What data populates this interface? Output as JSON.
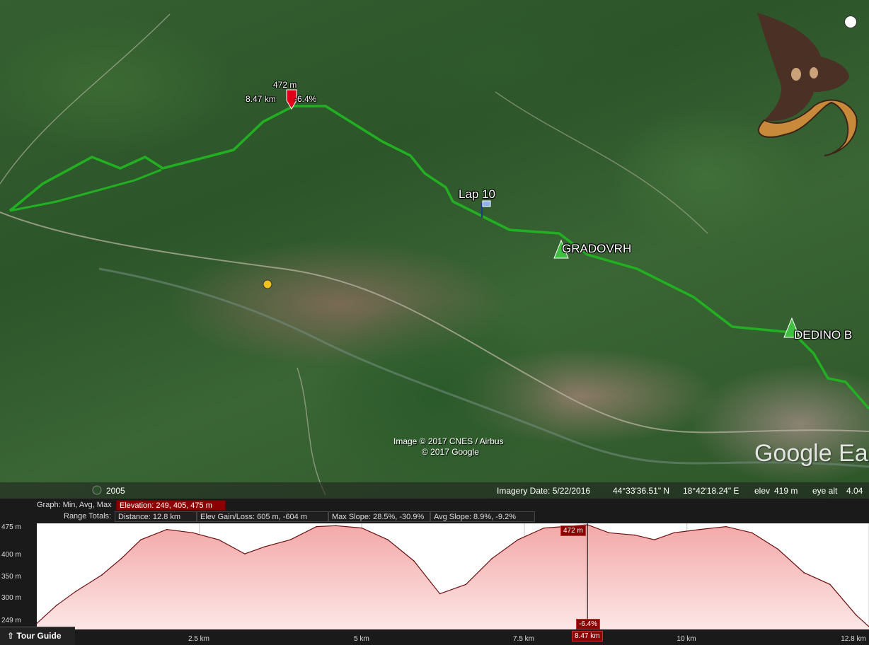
{
  "map": {
    "placemarks": {
      "gradovrh": "GRADOVRH",
      "dedino": "DEDINO B",
      "lap": "Lap 10"
    },
    "cursor_marker": {
      "elevation": "472 m",
      "distance": "8.47 km",
      "slope": "-6.4%"
    },
    "attribution": {
      "line1": "Image © 2017 CNES / Airbus",
      "line2": "© 2017 Google"
    },
    "brand": "Google Ea",
    "year_badge": "2005",
    "status": {
      "imagery_date": "Imagery Date: 5/22/2016",
      "lat": "44°33'36.51\" N",
      "lon": "18°42'18.24\" E",
      "elev_label": "elev",
      "elev_value": "419 m",
      "eye_alt": "eye alt",
      "eye_alt_value": "4.04"
    },
    "track_color": "#22b022"
  },
  "graph": {
    "label": "Graph: Min, Avg, Max",
    "elevation": "Elevation: 249, 405, 475 m",
    "range_totals": "Range Totals:",
    "distance": "Distance: 12.8 km",
    "elev_gain_loss": "Elev Gain/Loss: 605 m, -604 m",
    "max_slope": "Max Slope: 28.5%, -30.9%",
    "avg_slope": "Avg Slope: 8.9%, -9.2%",
    "y_ticks": [
      "475 m",
      "400 m",
      "350 m",
      "300 m",
      "249 m"
    ],
    "x_ticks": [
      "2.5 km",
      "5 km",
      "7.5 km",
      "10 km",
      "12.8 km"
    ],
    "cursor_x_label": "8.47 km",
    "cursor_top_label": "472 m",
    "cursor_bottom_label": "-6.4%"
  },
  "tour_guide": {
    "label": "Tour Guide"
  },
  "chart_data": {
    "type": "area",
    "title": "",
    "xlabel": "",
    "ylabel": "",
    "xlim": [
      0,
      12.8
    ],
    "ylim": [
      249,
      475
    ],
    "x": [
      0,
      0.3,
      0.6,
      1.0,
      1.3,
      1.6,
      2.0,
      2.4,
      2.8,
      3.2,
      3.5,
      3.9,
      4.3,
      4.6,
      5.0,
      5.4,
      5.8,
      6.2,
      6.6,
      7.0,
      7.4,
      7.8,
      8.1,
      8.47,
      8.8,
      9.2,
      9.5,
      9.8,
      10.2,
      10.6,
      11.0,
      11.4,
      11.8,
      12.2,
      12.6,
      12.8
    ],
    "y": [
      262,
      300,
      330,
      365,
      400,
      440,
      462,
      455,
      440,
      410,
      425,
      440,
      468,
      470,
      465,
      440,
      395,
      325,
      345,
      400,
      440,
      465,
      468,
      472,
      455,
      450,
      440,
      455,
      462,
      468,
      455,
      420,
      370,
      345,
      280,
      255
    ]
  }
}
